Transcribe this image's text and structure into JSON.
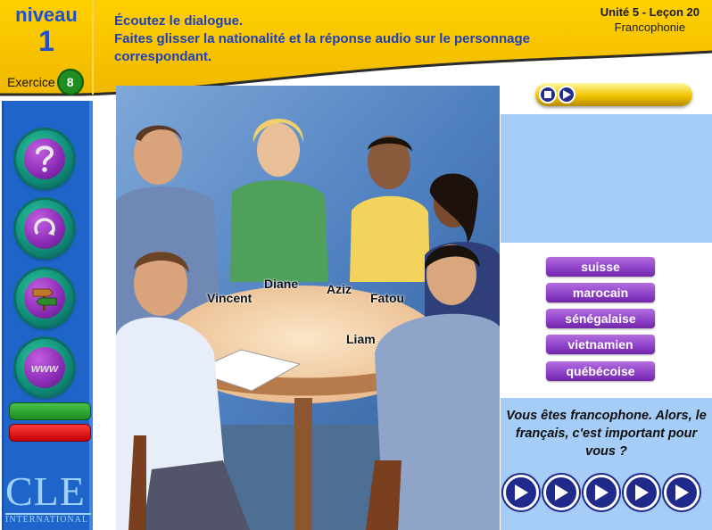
{
  "header": {
    "niveau_word": "niveau",
    "niveau_number": "1",
    "exercice_label": "Exercice",
    "exercice_number": "8",
    "instruction_line1": "Écoutez le dialogue.",
    "instruction_line2": "Faites glisser la nationalité et la réponse audio sur le personnage correspondant.",
    "unit": "Unité 5 - Leçon 20",
    "topic": "Francophonie"
  },
  "sidebar": {
    "buttons": [
      {
        "name": "help-button",
        "icon": "question-mark-icon"
      },
      {
        "name": "retry-button",
        "icon": "circular-arrow-icon"
      },
      {
        "name": "navigation-button",
        "icon": "signpost-icon"
      },
      {
        "name": "web-button",
        "icon": "www-icon",
        "text": "www"
      }
    ],
    "logo_text": "CLE",
    "logo_subtext": "INTERNATIONAL"
  },
  "characters": [
    "Vincent",
    "Diane",
    "Aziz",
    "Fatou",
    "Liam"
  ],
  "nationalities": [
    "suisse",
    "marocain",
    "sénégalaise",
    "vietnamien",
    "québécoise"
  ],
  "question": "Vous êtes francophone. Alors, le français, c'est important pour vous ?",
  "audio_clip_count": 5,
  "colors": {
    "header_yellow": "#f5c200",
    "sidebar_blue": "#1f65c9",
    "panel_blue": "#a6cdf7",
    "nationality_purple": "#8c3fc6",
    "play_navy": "#1f2a8a"
  }
}
